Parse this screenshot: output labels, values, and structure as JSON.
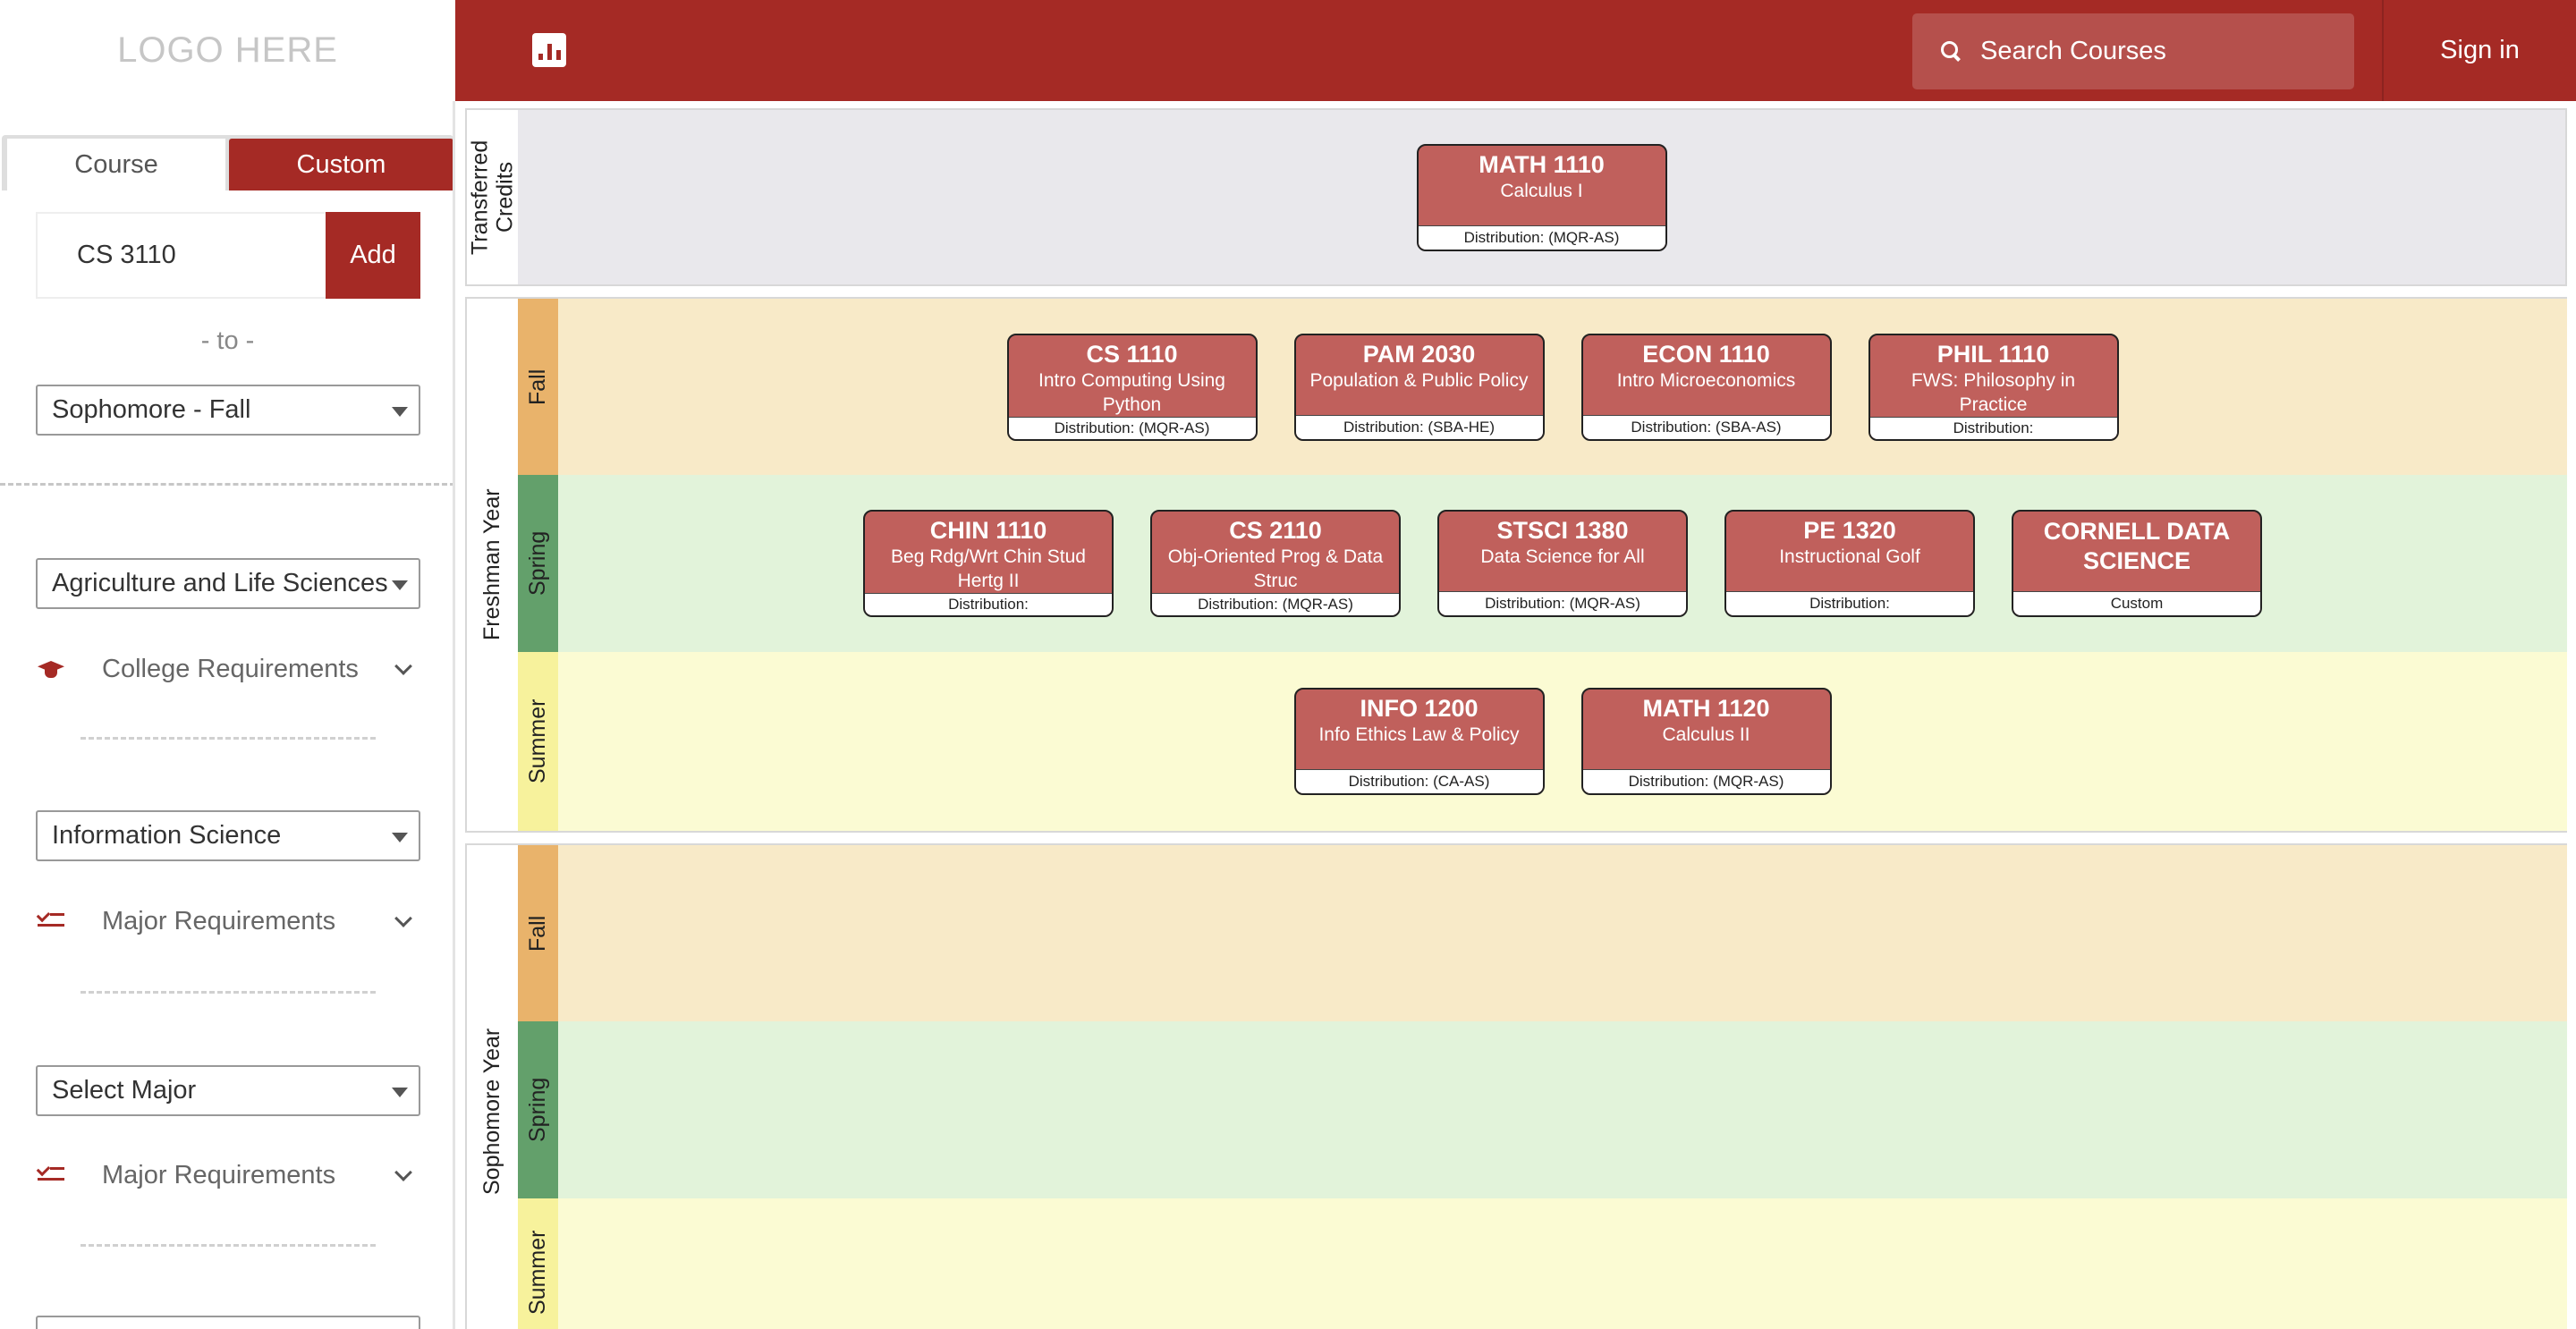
{
  "header": {
    "logo": "LOGO HERE",
    "search_placeholder": "Search Courses",
    "sign_in": "Sign in",
    "chart_icon": "bar-chart-icon"
  },
  "sidebar": {
    "tabs": [
      "Course",
      "Custom"
    ],
    "course_input": "CS 3110",
    "add_label": "Add",
    "to_label": "- to -",
    "target_semester": "Sophomore - Fall",
    "college_select": "Agriculture and Life Sciences",
    "college_req": "College Requirements",
    "major_select": "Information Science",
    "major_req": "Major Requirements",
    "major2_select": "Select Major",
    "major2_req": "Major Requirements"
  },
  "plan": {
    "transfer_label": "Transferred Credits",
    "transfer_courses": [
      {
        "code": "MATH 1110",
        "title": "Calculus I",
        "dist": "Distribution: (MQR-AS)"
      }
    ],
    "freshman": {
      "label": "Freshman Year",
      "fall_label": "Fall",
      "spring_label": "Spring",
      "summer_label": "Summer",
      "fall": [
        {
          "code": "CS 1110",
          "title": "Intro Computing Using Python",
          "dist": "Distribution: (MQR-AS)"
        },
        {
          "code": "PAM 2030",
          "title": "Population & Public Policy",
          "dist": "Distribution: (SBA-HE)"
        },
        {
          "code": "ECON 1110",
          "title": "Intro Microeconomics",
          "dist": "Distribution: (SBA-AS)"
        },
        {
          "code": "PHIL 1110",
          "title": "FWS: Philosophy in Practice",
          "dist": "Distribution:"
        }
      ],
      "spring": [
        {
          "code": "CHIN 1110",
          "title": "Beg Rdg/Wrt Chin Stud Hertg II",
          "dist": "Distribution:"
        },
        {
          "code": "CS 2110",
          "title": "Obj-Oriented Prog & Data Struc",
          "dist": "Distribution: (MQR-AS)"
        },
        {
          "code": "STSCI 1380",
          "title": "Data Science for All",
          "dist": "Distribution: (MQR-AS)"
        },
        {
          "code": "PE 1320",
          "title": "Instructional Golf",
          "dist": "Distribution:"
        },
        {
          "code": "CORNELL DATA SCIENCE",
          "title": "",
          "dist": "Custom"
        }
      ],
      "summer": [
        {
          "code": "INFO 1200",
          "title": "Info Ethics Law & Policy",
          "dist": "Distribution: (CA-AS)"
        },
        {
          "code": "MATH 1120",
          "title": "Calculus II",
          "dist": "Distribution: (MQR-AS)"
        }
      ]
    },
    "sophomore": {
      "label": "Sophomore Year",
      "fall_label": "Fall",
      "spring_label": "Spring",
      "summer_label": "Summer"
    }
  }
}
